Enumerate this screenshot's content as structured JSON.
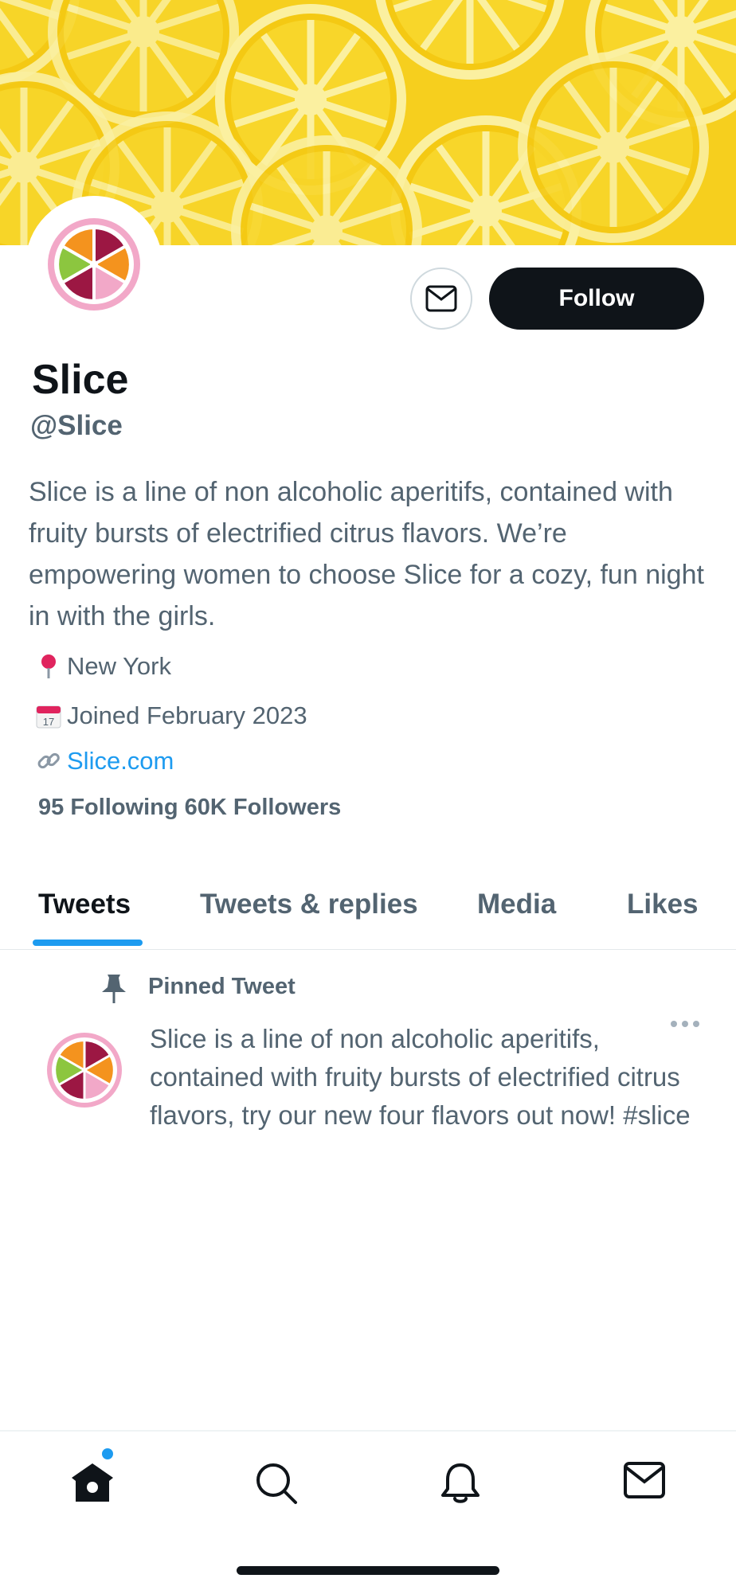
{
  "profile": {
    "name": "Slice",
    "handle": "@Slice",
    "bio": "Slice is a line of non alcoholic aperitifs, contained with fruity bursts of electrified citrus flavors. We’re empowering women to choose Slice for a cozy, fun night in with the girls.",
    "location": "New York",
    "joined": "Joined February 2023",
    "website": "Slice.com",
    "stats": "95 Following 60K Followers",
    "location_icon": "pin-icon",
    "joined_icon": "calendar-icon",
    "website_icon": "link-icon"
  },
  "actions": {
    "follow_label": "Follow",
    "message_icon": "envelope-icon"
  },
  "tabs": [
    {
      "label": "Tweets",
      "active": true
    },
    {
      "label": "Tweets & replies",
      "active": false
    },
    {
      "label": "Media",
      "active": false
    },
    {
      "label": "Likes",
      "active": false
    }
  ],
  "pinned_tweet": {
    "label": "Pinned Tweet",
    "text": "Slice is a line of non alcoholic aperitifs, contained with fruity bursts of electrified citrus flavors, try our new four flavors out now! #slice"
  },
  "bottom_nav": [
    {
      "icon": "home-icon",
      "has_notification_dot": true
    },
    {
      "icon": "search-icon"
    },
    {
      "icon": "bell-icon"
    },
    {
      "icon": "envelope-icon"
    }
  ],
  "colors": {
    "accent": "#1d9bf0",
    "banner": "#f6cf1e",
    "follow_button": "#0f1419",
    "secondary_text": "#536471"
  }
}
